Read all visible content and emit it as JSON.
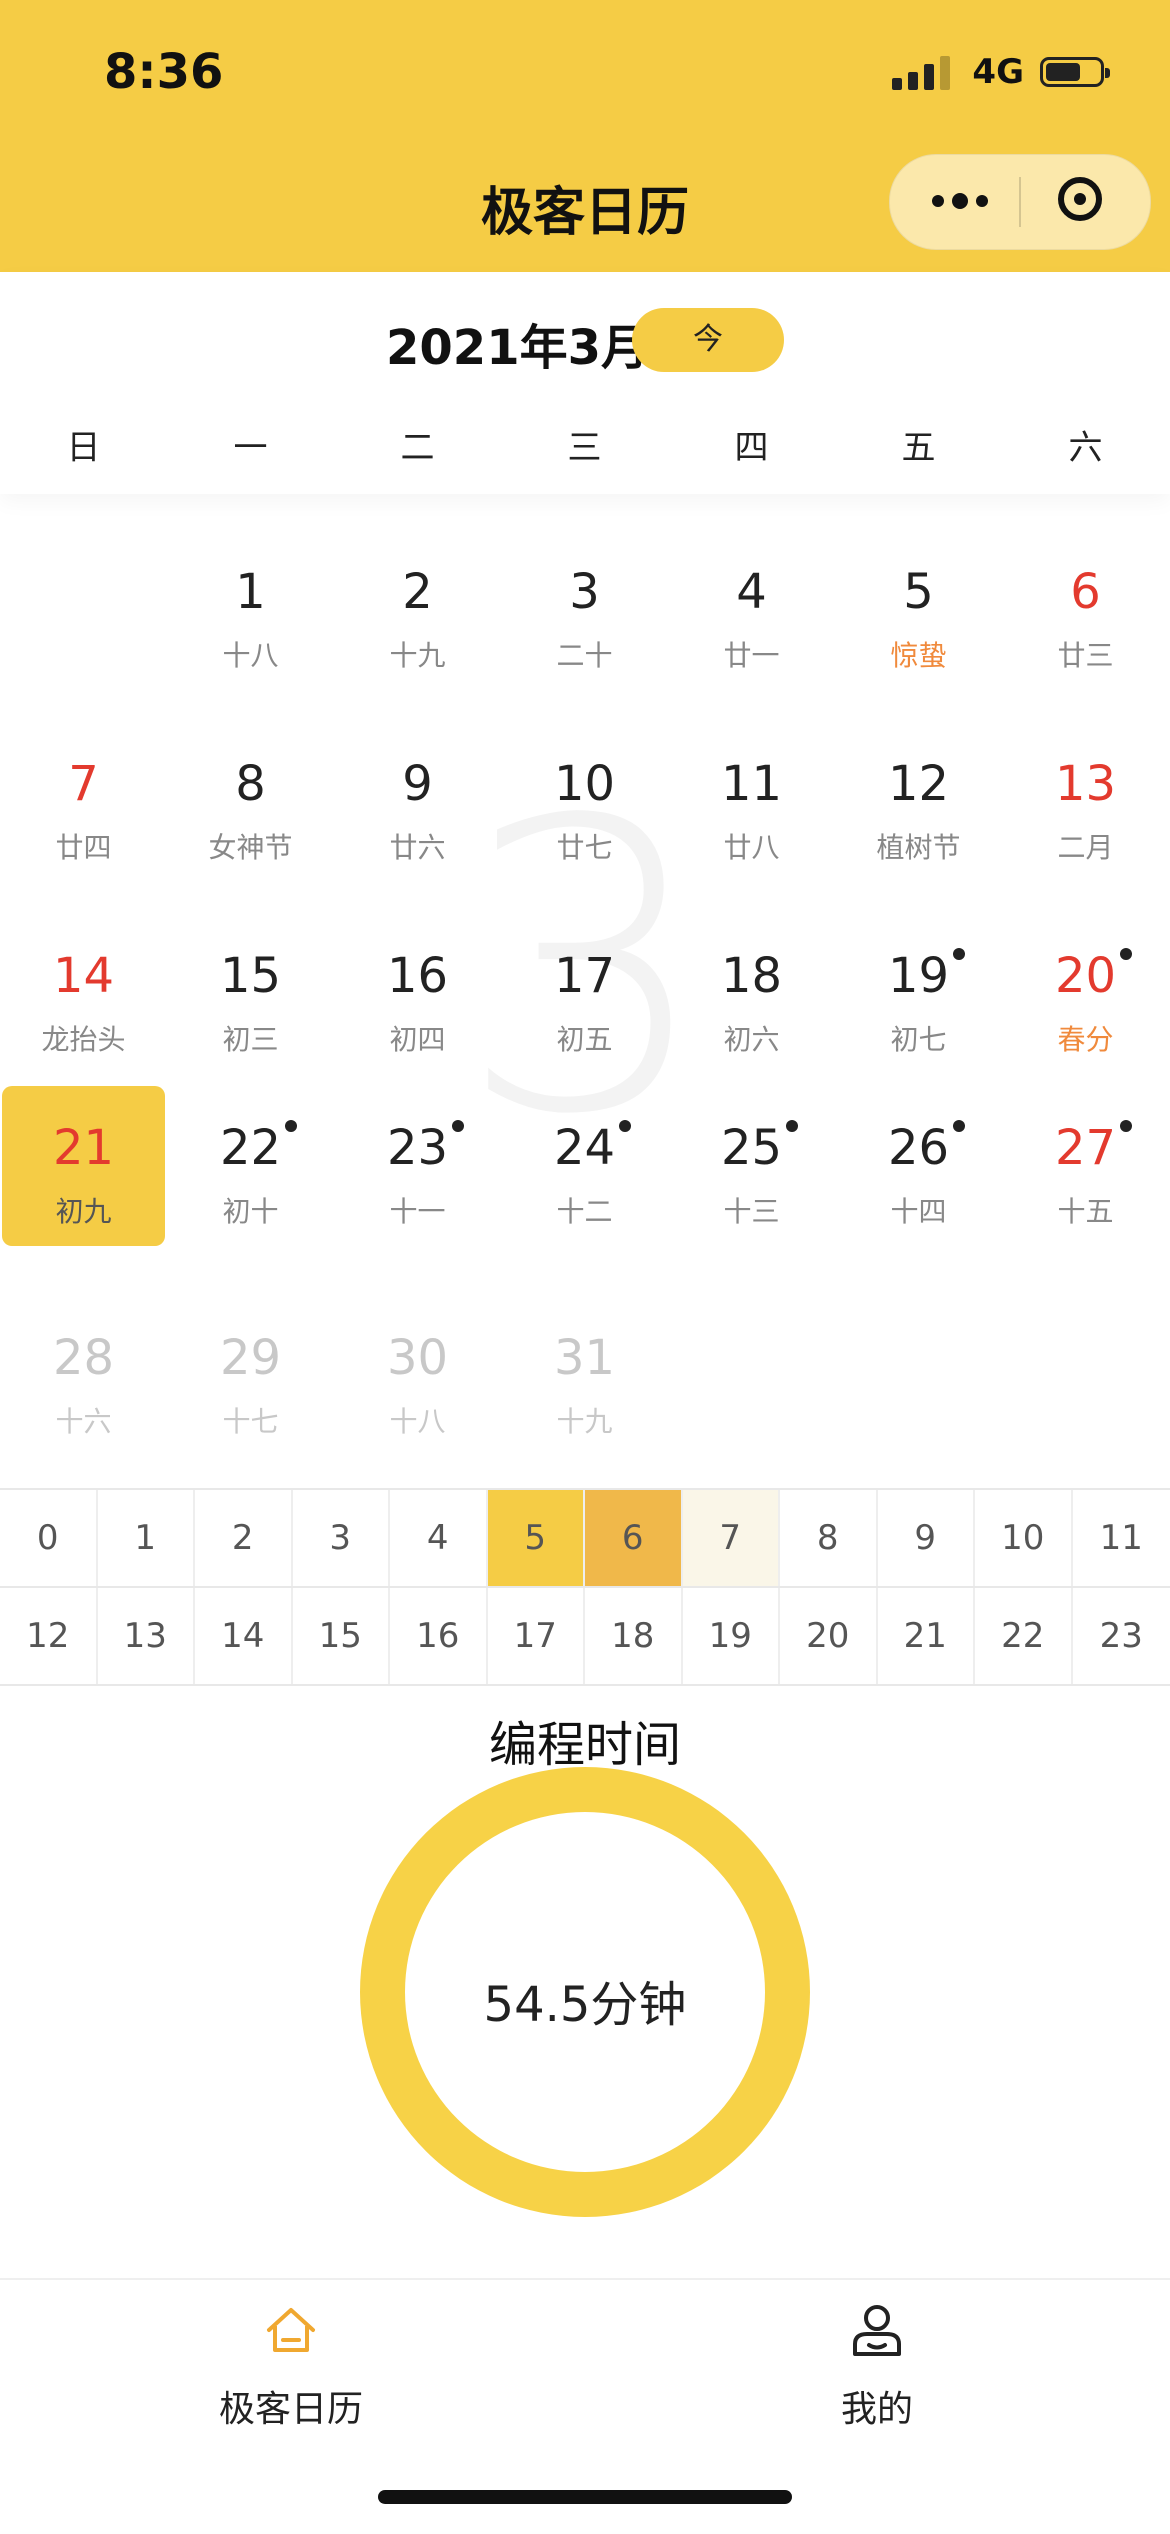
{
  "status_bar": {
    "time": "8:36",
    "network": "4G"
  },
  "nav": {
    "title": "极客日历"
  },
  "calendar": {
    "month_label": "2021年3月",
    "today_button": "今",
    "big_month": "3",
    "weekdays": [
      "日",
      "一",
      "二",
      "三",
      "四",
      "五",
      "六"
    ],
    "weeks": [
      [
        null,
        {
          "day": "1",
          "lunar": "十八"
        },
        {
          "day": "2",
          "lunar": "十九"
        },
        {
          "day": "3",
          "lunar": "二十"
        },
        {
          "day": "4",
          "lunar": "廿一"
        },
        {
          "day": "5",
          "lunar": "惊蛰",
          "festival": true
        },
        {
          "day": "6",
          "lunar": "廿三",
          "red": true
        }
      ],
      [
        {
          "day": "7",
          "lunar": "廿四",
          "red": true
        },
        {
          "day": "8",
          "lunar": "女神节"
        },
        {
          "day": "9",
          "lunar": "廿六"
        },
        {
          "day": "10",
          "lunar": "廿七"
        },
        {
          "day": "11",
          "lunar": "廿八"
        },
        {
          "day": "12",
          "lunar": "植树节"
        },
        {
          "day": "13",
          "lunar": "二月",
          "red": true
        }
      ],
      [
        {
          "day": "14",
          "lunar": "龙抬头",
          "red": true
        },
        {
          "day": "15",
          "lunar": "初三"
        },
        {
          "day": "16",
          "lunar": "初四"
        },
        {
          "day": "17",
          "lunar": "初五"
        },
        {
          "day": "18",
          "lunar": "初六"
        },
        {
          "day": "19",
          "lunar": "初七",
          "dot": true
        },
        {
          "day": "20",
          "lunar": "春分",
          "red": true,
          "festival": true,
          "dot": true
        }
      ],
      [
        {
          "day": "21",
          "lunar": "初九",
          "red": true,
          "selected": true
        },
        {
          "day": "22",
          "lunar": "初十",
          "dot": true
        },
        {
          "day": "23",
          "lunar": "十一",
          "dot": true
        },
        {
          "day": "24",
          "lunar": "十二",
          "dot": true
        },
        {
          "day": "25",
          "lunar": "十三",
          "dot": true
        },
        {
          "day": "26",
          "lunar": "十四",
          "dot": true
        },
        {
          "day": "27",
          "lunar": "十五",
          "red": true,
          "dot": true
        }
      ],
      [
        {
          "day": "28",
          "lunar": "十六",
          "gray": true
        },
        {
          "day": "29",
          "lunar": "十七",
          "gray": true
        },
        {
          "day": "30",
          "lunar": "十八",
          "gray": true
        },
        {
          "day": "31",
          "lunar": "十九",
          "gray": true
        },
        null,
        null,
        null
      ]
    ]
  },
  "hours": {
    "rows": [
      [
        "0",
        "1",
        "2",
        "3",
        "4",
        "5",
        "6",
        "7",
        "8",
        "9",
        "10",
        "11"
      ],
      [
        "12",
        "13",
        "14",
        "15",
        "16",
        "17",
        "18",
        "19",
        "20",
        "21",
        "22",
        "23"
      ]
    ],
    "highlights": {
      "5": "#F5CC45",
      "6": "#F0B84A",
      "7": "#FAF6E8"
    }
  },
  "stat": {
    "title": "编程时间",
    "value": "54.5分钟",
    "ring_color": "#F7D247"
  },
  "tabbar": {
    "items": [
      {
        "label": "极客日历",
        "icon": "home-icon"
      },
      {
        "label": "我的",
        "icon": "user-icon"
      }
    ]
  },
  "colors": {
    "accent": "#F5CC45",
    "red": "#E33A2E",
    "festival": "#F08A3C"
  }
}
